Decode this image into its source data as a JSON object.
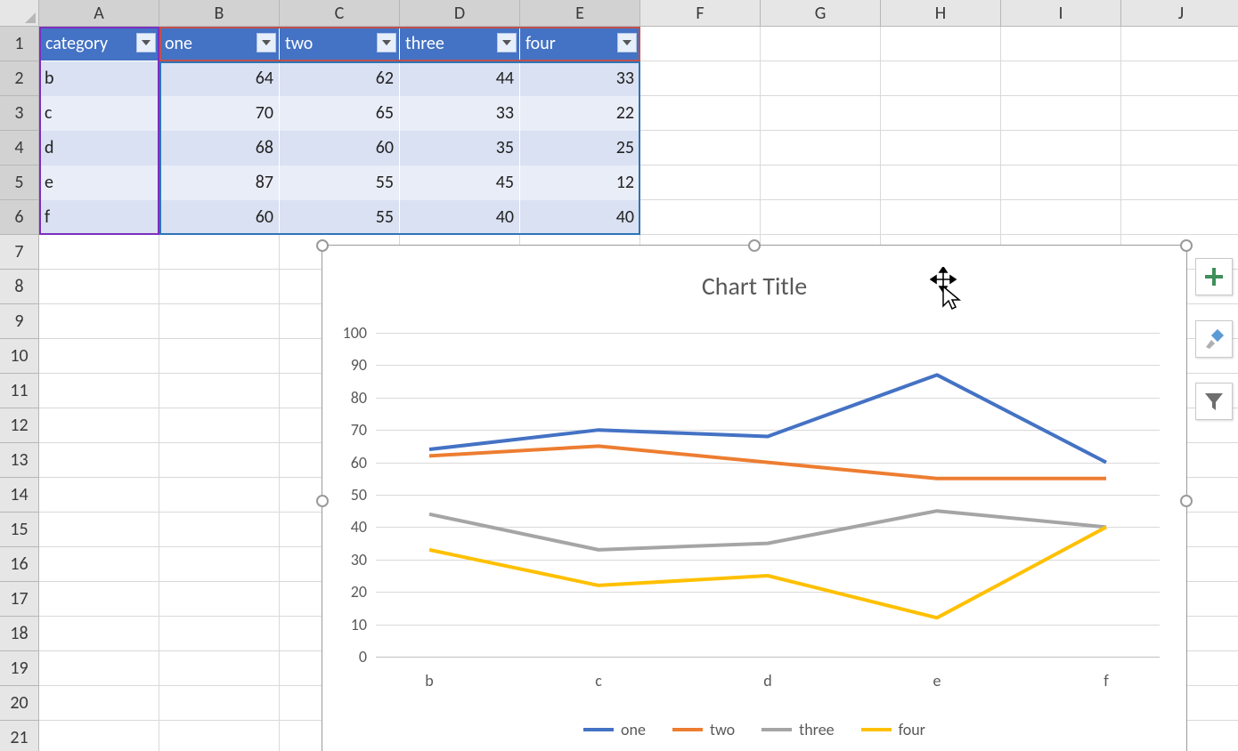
{
  "grid": {
    "col_letters": [
      "A",
      "B",
      "C",
      "D",
      "E",
      "F",
      "G",
      "H",
      "I",
      "J"
    ],
    "row_numbers": [
      1,
      2,
      3,
      4,
      5,
      6,
      7,
      8,
      9,
      10,
      11,
      12,
      13,
      14,
      15,
      16,
      17,
      18,
      19,
      20,
      21
    ],
    "selected_cols": [
      "A",
      "B",
      "C",
      "D",
      "E"
    ],
    "selected_rows": [
      1,
      2,
      3,
      4,
      5,
      6
    ]
  },
  "table": {
    "headers": [
      "category",
      "one",
      "two",
      "three",
      "four"
    ],
    "rows": [
      {
        "category": "b",
        "one": 64,
        "two": 62,
        "three": 44,
        "four": 33
      },
      {
        "category": "c",
        "one": 70,
        "two": 65,
        "three": 33,
        "four": 22
      },
      {
        "category": "d",
        "one": 68,
        "two": 60,
        "three": 35,
        "four": 25
      },
      {
        "category": "e",
        "one": 87,
        "two": 55,
        "three": 45,
        "four": 12
      },
      {
        "category": "f",
        "one": 60,
        "two": 55,
        "three": 40,
        "four": 40
      }
    ]
  },
  "chart": {
    "title": "Chart Title",
    "legend": [
      "one",
      "two",
      "three",
      "four"
    ],
    "series_colors": {
      "one": "#4472c4",
      "two": "#ed7d31",
      "three": "#a5a5a5",
      "four": "#ffc000"
    }
  },
  "chart_data": {
    "type": "line",
    "title": "Chart Title",
    "xlabel": "",
    "ylabel": "",
    "ylim": [
      0,
      100
    ],
    "yticks": [
      0,
      10,
      20,
      30,
      40,
      50,
      60,
      70,
      80,
      90,
      100
    ],
    "categories": [
      "b",
      "c",
      "d",
      "e",
      "f"
    ],
    "series": [
      {
        "name": "one",
        "values": [
          64,
          70,
          68,
          87,
          60
        ]
      },
      {
        "name": "two",
        "values": [
          62,
          65,
          60,
          55,
          55
        ]
      },
      {
        "name": "three",
        "values": [
          44,
          33,
          35,
          45,
          40
        ]
      },
      {
        "name": "four",
        "values": [
          33,
          22,
          25,
          12,
          40
        ]
      }
    ],
    "legend_position": "bottom",
    "grid": true
  },
  "side_buttons": [
    "chart-elements",
    "chart-styles",
    "chart-filters"
  ]
}
